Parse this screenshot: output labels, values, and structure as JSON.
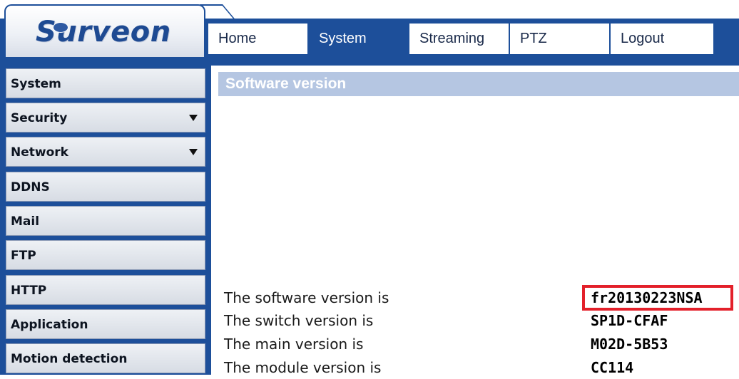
{
  "brand": {
    "logo_text": "Surveon"
  },
  "nav": {
    "tabs": [
      {
        "label": "Home",
        "active": false
      },
      {
        "label": "System",
        "active": true
      },
      {
        "label": "Streaming",
        "active": false
      },
      {
        "label": "PTZ",
        "active": false
      },
      {
        "label": "Logout",
        "active": false
      }
    ]
  },
  "sidebar": {
    "items": [
      {
        "label": "System",
        "has_arrow": false
      },
      {
        "label": "Security",
        "has_arrow": true
      },
      {
        "label": "Network",
        "has_arrow": true
      },
      {
        "label": "DDNS",
        "has_arrow": false
      },
      {
        "label": "Mail",
        "has_arrow": false
      },
      {
        "label": "FTP",
        "has_arrow": false
      },
      {
        "label": "HTTP",
        "has_arrow": false
      },
      {
        "label": "Application",
        "has_arrow": false
      },
      {
        "label": "Motion detection",
        "has_arrow": false
      }
    ]
  },
  "main": {
    "section_title": "Software version",
    "rows": [
      {
        "label": "The software version is",
        "value": "fr20130223NSA",
        "highlighted": true
      },
      {
        "label": "The switch version is",
        "value": "SP1D-CFAF",
        "highlighted": false
      },
      {
        "label": "The main version is",
        "value": "M02D-5B53",
        "highlighted": false
      },
      {
        "label": "The module version is",
        "value": "CC114",
        "highlighted": false
      }
    ]
  },
  "colors": {
    "brand_blue": "#1d4f9a",
    "section_header_bg": "#b5c6e2",
    "highlight_red": "#e3202a"
  }
}
